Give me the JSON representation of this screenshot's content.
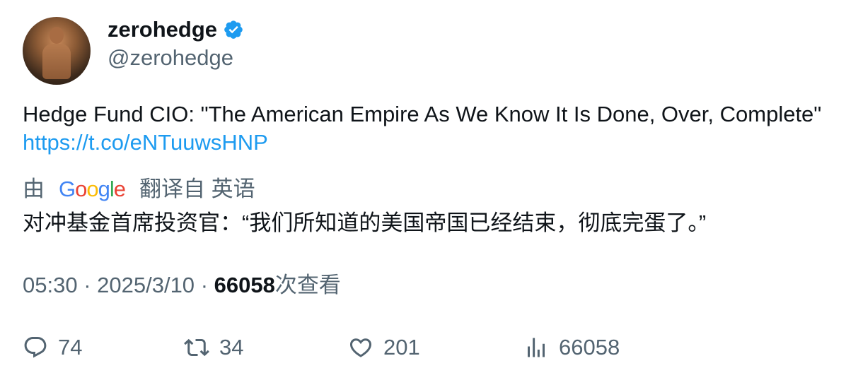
{
  "author": {
    "name": "zerohedge",
    "handle": "@zerohedge",
    "verified": true
  },
  "tweet": {
    "text": "Hedge Fund CIO: \"The American Empire As We Know It Is Done, Over, Complete\"",
    "link": "https://t.co/eNTuuwsHNP"
  },
  "translation": {
    "by": "由",
    "provider": "Google",
    "from_label": "翻译自 英语",
    "text": "对冲基金首席投资官：“我们所知道的美国帝国已经结束，彻底完蛋了。”"
  },
  "meta": {
    "time": "05:30",
    "date": "2025/3/10",
    "views": "66058",
    "views_label": "次查看"
  },
  "actions": {
    "replies": "74",
    "retweets": "34",
    "likes": "201",
    "views": "66058"
  },
  "colors": {
    "accent": "#1d9bf0",
    "secondary_text": "#536471",
    "primary_text": "#0f1419"
  }
}
